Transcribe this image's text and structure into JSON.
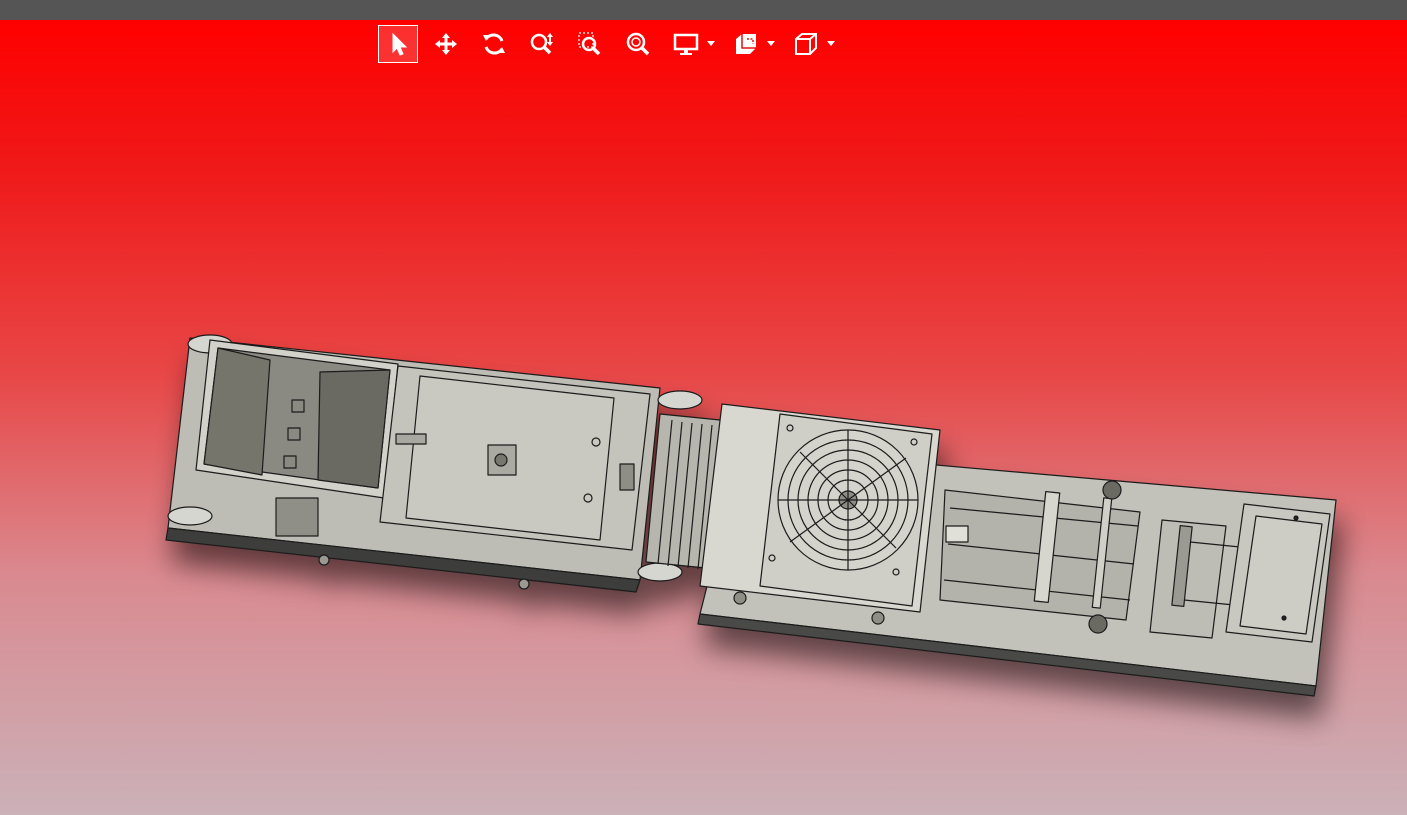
{
  "window": {
    "title_bar": ""
  },
  "toolbar": {
    "buttons": [
      {
        "id": "select",
        "icon": "select-arrow-icon",
        "active": true
      },
      {
        "id": "pan",
        "icon": "pan-move-icon",
        "active": false
      },
      {
        "id": "rotate",
        "icon": "rotate-icon",
        "active": false
      },
      {
        "id": "zoom",
        "icon": "zoom-icon",
        "active": false
      },
      {
        "id": "zoom-window",
        "icon": "zoom-window-icon",
        "active": false
      },
      {
        "id": "zoom-fit",
        "icon": "zoom-fit-icon",
        "active": false
      },
      {
        "id": "display-mode",
        "icon": "display-monitor-icon",
        "active": false,
        "dropdown": true
      },
      {
        "id": "section-view",
        "icon": "section-view-icon",
        "active": false,
        "dropdown": true
      },
      {
        "id": "standard-views",
        "icon": "standard-view-cube-icon",
        "active": false,
        "dropdown": true
      }
    ]
  },
  "viewport": {
    "background_top": "#ff0000",
    "background_bottom": "#cbb1b8",
    "model": "conveyor-machine-assembly"
  },
  "colors": {
    "part_fill": "#c4c4bc",
    "part_dark": "#7c7c74",
    "edge": "#1a1a1a",
    "active_outline": "#ffffff",
    "icon": "#ffffff"
  }
}
